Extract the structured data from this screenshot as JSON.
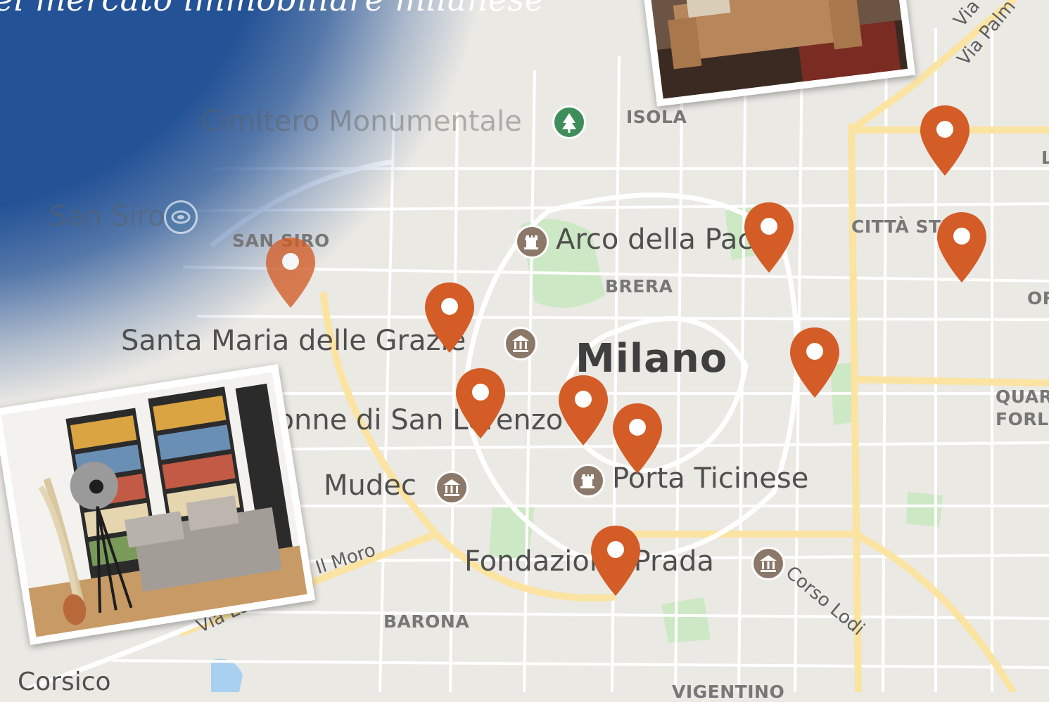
{
  "tagline": "el mercato immobiliare milanese",
  "map": {
    "city_label": "Milano",
    "places": [
      {
        "id": "monumentale",
        "label": "Cimitero Monumentale",
        "icon": "park-icon"
      },
      {
        "id": "san-siro-stadium",
        "label": "San Siro",
        "icon": "stadium-icon"
      },
      {
        "id": "arco",
        "label": "Arco della Pace",
        "icon": "monument-icon"
      },
      {
        "id": "grazie",
        "label": "Santa Maria delle Grazie",
        "icon": "museum-icon"
      },
      {
        "id": "colonne",
        "label": "Colonne di San Lorenzo",
        "icon": "monument-icon"
      },
      {
        "id": "mudec",
        "label": "Mudec",
        "icon": "museum-icon"
      },
      {
        "id": "ticinese",
        "label": "Porta Ticinese",
        "icon": "monument-icon"
      },
      {
        "id": "prada",
        "label": "Fondazione Prada",
        "icon": "museum-icon"
      }
    ],
    "districts": [
      {
        "id": "isola",
        "label": "ISOLA"
      },
      {
        "id": "sansiro",
        "label": "SAN SIRO"
      },
      {
        "id": "brera",
        "label": "BRERA"
      },
      {
        "id": "cittastudi",
        "label": "CITTÀ STUDI"
      },
      {
        "id": "barona",
        "label": "BARONA"
      },
      {
        "id": "quartiere-forl",
        "label": "QUAR"
      },
      {
        "id": "quartiere-forl2",
        "label": "FORL"
      },
      {
        "id": "ortica",
        "label": "OR"
      },
      {
        "id": "vigentino",
        "label": "VIGENTINO"
      },
      {
        "id": "lambrate",
        "label": "L"
      }
    ],
    "roads": [
      {
        "id": "corso-lodi",
        "label": "Corso Lodi"
      },
      {
        "id": "via-palmanova",
        "label": "Via Palm"
      },
      {
        "id": "via-palmanova-2",
        "label": "Via"
      },
      {
        "id": "via-ludovico",
        "label": "Via Lo"
      },
      {
        "id": "il-moro",
        "label": "Il Moro"
      }
    ],
    "towns": [
      {
        "id": "corsico",
        "label": "Corsico"
      }
    ],
    "marker_color": "#d35c27",
    "marker_count": 12,
    "colors": {
      "land": "#ebe9e4",
      "road": "#ffffff",
      "major_road": "#fbe3a1",
      "park": "#cde8c4",
      "water": "#a8d0ef",
      "overlay": "#23528f"
    }
  },
  "photos": [
    {
      "id": "living-room-bookshelf",
      "icon": "photo-living-room-bookshelf"
    },
    {
      "id": "living-room-sofa",
      "icon": "photo-living-room-sofa"
    }
  ]
}
